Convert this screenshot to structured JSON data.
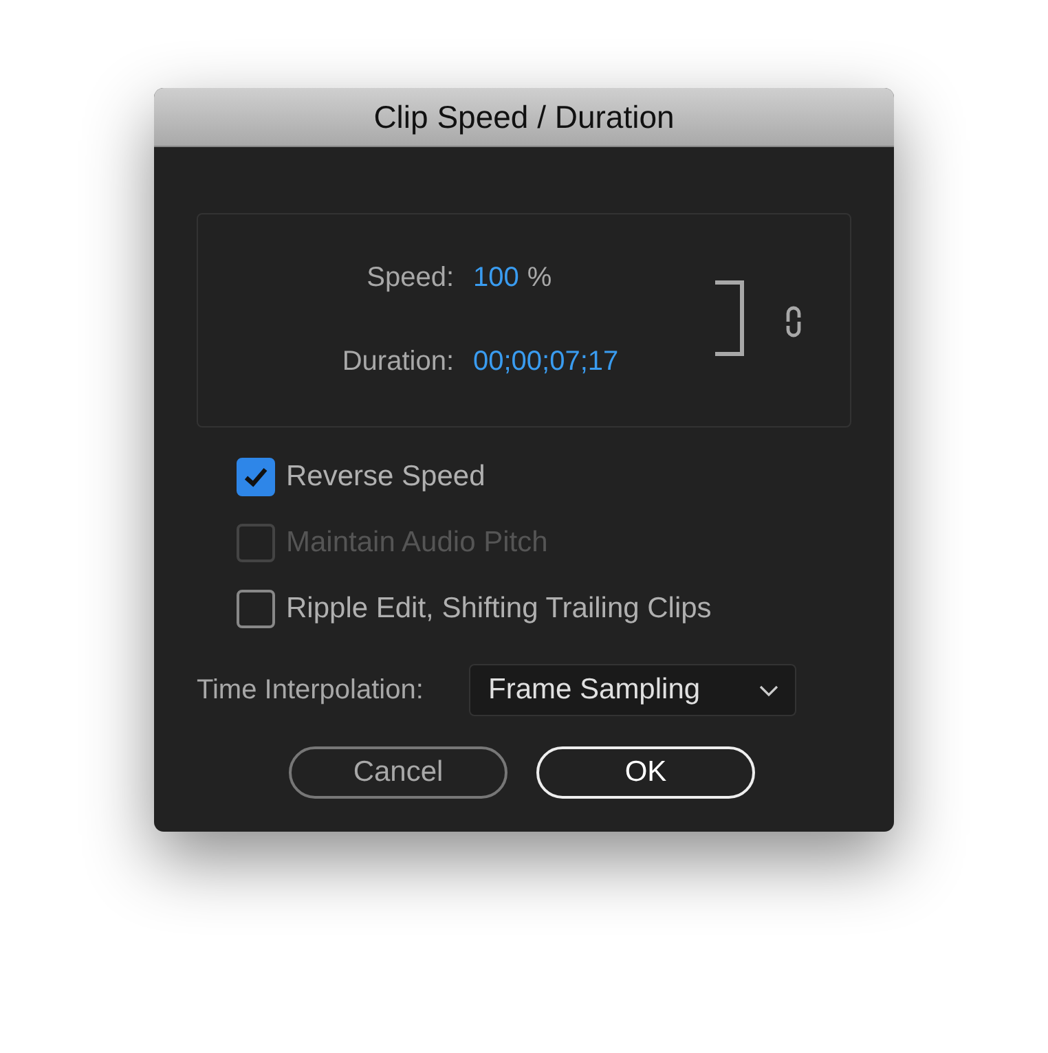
{
  "window": {
    "title": "Clip Speed / Duration"
  },
  "fields": [
    {
      "label": "Speed:",
      "value": "100",
      "unit": "%"
    },
    {
      "label": "Duration:",
      "value": "00;00;07;17"
    }
  ],
  "link": {
    "linked": true
  },
  "options": [
    {
      "label": "Reverse Speed",
      "checked": true,
      "disabled": false
    },
    {
      "label": "Maintain Audio Pitch",
      "checked": false,
      "disabled": true
    },
    {
      "label": "Ripple Edit, Shifting Trailing Clips",
      "checked": false,
      "disabled": false
    }
  ],
  "interpolation": {
    "label": "Time Interpolation:",
    "value": "Frame Sampling"
  },
  "buttons": [
    {
      "label": "Cancel",
      "default": false
    },
    {
      "label": "OK",
      "default": true
    }
  ]
}
